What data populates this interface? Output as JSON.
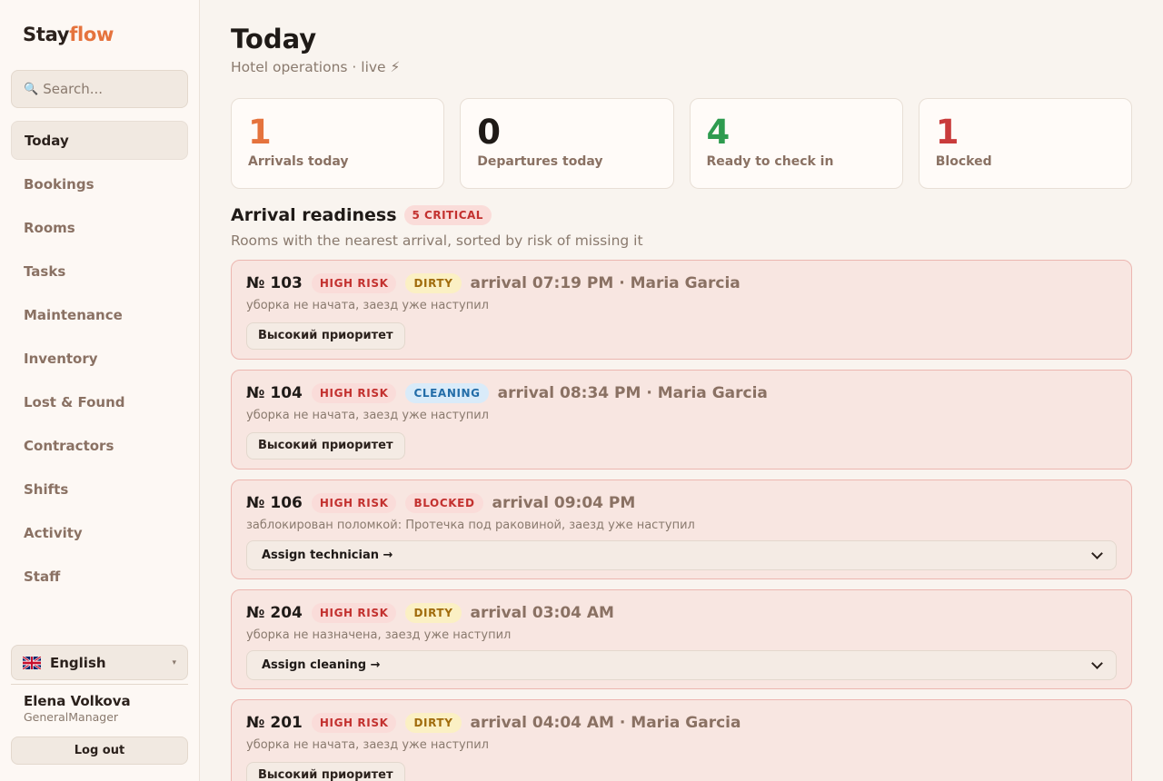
{
  "app": {
    "name_part1": "Stay",
    "name_part2": "flow"
  },
  "search": {
    "icon": "🔍",
    "placeholder": "Search..."
  },
  "nav": [
    {
      "label": "Today",
      "active": true
    },
    {
      "label": "Bookings"
    },
    {
      "label": "Rooms"
    },
    {
      "label": "Tasks"
    },
    {
      "label": "Maintenance"
    },
    {
      "label": "Inventory"
    },
    {
      "label": "Lost & Found"
    },
    {
      "label": "Contractors"
    },
    {
      "label": "Shifts"
    },
    {
      "label": "Activity"
    },
    {
      "label": "Staff"
    }
  ],
  "language": {
    "label": "English",
    "flag": "uk-flag-icon",
    "caret": "▾"
  },
  "user": {
    "name": "Elena Volkova",
    "role": "GeneralManager",
    "logout_label": "Log out"
  },
  "header": {
    "title": "Today",
    "subtitle": "Hotel operations · live ⚡"
  },
  "stats": [
    {
      "value": "1",
      "label": "Arrivals today",
      "color": "#e5733d"
    },
    {
      "value": "0",
      "label": "Departures today",
      "color": "#1f1a17"
    },
    {
      "value": "4",
      "label": "Ready to check in",
      "color": "#2e9b4f"
    },
    {
      "value": "1",
      "label": "Blocked",
      "color": "#c93b3b"
    }
  ],
  "readiness": {
    "title": "Arrival readiness",
    "badge": "5 CRITICAL",
    "subtitle": "Rooms with the nearest arrival, sorted by risk of missing it",
    "cards": [
      {
        "room": "№ 103",
        "risk": "HIGH RISK",
        "status": "DIRTY",
        "status_type": "dirty",
        "arrival": "arrival 07:19 PM",
        "guest": " · Maria Garcia",
        "note": "уборка не начата, заезд уже наступил",
        "action_type": "button",
        "action": "Высокий приоритет"
      },
      {
        "room": "№ 104",
        "risk": "HIGH RISK",
        "status": "CLEANING",
        "status_type": "cleaning",
        "arrival": "arrival 08:34 PM",
        "guest": " · Maria Garcia",
        "note": "уборка не начата, заезд уже наступил",
        "action_type": "button",
        "action": "Высокий приоритет"
      },
      {
        "room": "№ 106",
        "risk": "HIGH RISK",
        "status": "BLOCKED",
        "status_type": "blocked",
        "arrival": "arrival 09:04 PM",
        "guest": "",
        "note": "заблокирован поломкой: Протечка под раковиной, заезд уже наступил",
        "action_type": "select",
        "action": "Assign technician →"
      },
      {
        "room": "№ 204",
        "risk": "HIGH RISK",
        "status": "DIRTY",
        "status_type": "dirty",
        "arrival": "arrival 03:04 AM",
        "guest": "",
        "note": "уборка не назначена, заезд уже наступил",
        "action_type": "select",
        "action": "Assign cleaning →"
      },
      {
        "room": "№ 201",
        "risk": "HIGH RISK",
        "status": "DIRTY",
        "status_type": "dirty",
        "arrival": "arrival 04:04 AM",
        "guest": " · Maria Garcia",
        "note": "уборка не начата, заезд уже наступил",
        "action_type": "button",
        "action": "Высокий приоритет"
      }
    ]
  }
}
